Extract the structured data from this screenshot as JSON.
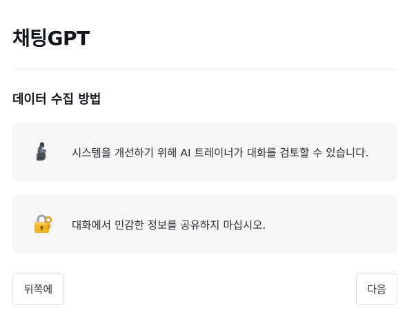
{
  "app": {
    "title": "채팅GPT"
  },
  "section": {
    "heading": "데이터 수집 방법"
  },
  "cards": [
    {
      "icon": "flexed-biceps-icon",
      "text": "시스템을 개선하기 위해 AI 트레이너가 대화를 검토할 수 있습니다."
    },
    {
      "icon": "locked-with-key-icon",
      "text": "대화에서 민감한 정보를 공유하지 마십시오."
    }
  ],
  "buttons": {
    "back_label": "뒤쪽에",
    "next_label": "다음"
  }
}
